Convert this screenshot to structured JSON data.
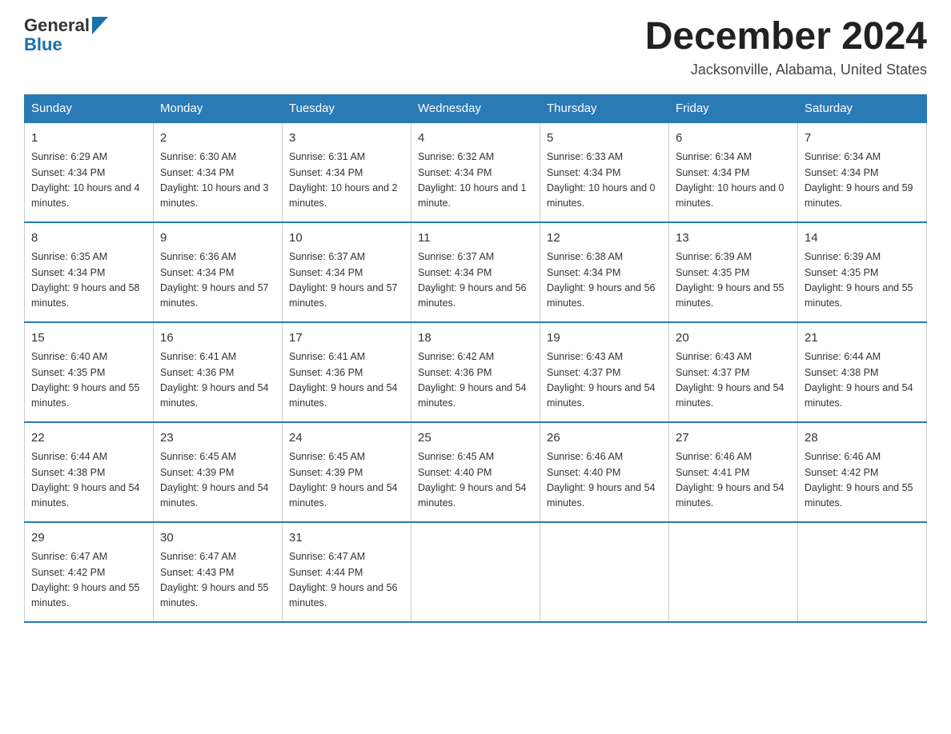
{
  "logo": {
    "general": "General",
    "blue": "Blue"
  },
  "header": {
    "title": "December 2024",
    "subtitle": "Jacksonville, Alabama, United States"
  },
  "days": [
    "Sunday",
    "Monday",
    "Tuesday",
    "Wednesday",
    "Thursday",
    "Friday",
    "Saturday"
  ],
  "weeks": [
    [
      {
        "date": "1",
        "sunrise": "6:29 AM",
        "sunset": "4:34 PM",
        "daylight": "10 hours and 4 minutes."
      },
      {
        "date": "2",
        "sunrise": "6:30 AM",
        "sunset": "4:34 PM",
        "daylight": "10 hours and 3 minutes."
      },
      {
        "date": "3",
        "sunrise": "6:31 AM",
        "sunset": "4:34 PM",
        "daylight": "10 hours and 2 minutes."
      },
      {
        "date": "4",
        "sunrise": "6:32 AM",
        "sunset": "4:34 PM",
        "daylight": "10 hours and 1 minute."
      },
      {
        "date": "5",
        "sunrise": "6:33 AM",
        "sunset": "4:34 PM",
        "daylight": "10 hours and 0 minutes."
      },
      {
        "date": "6",
        "sunrise": "6:34 AM",
        "sunset": "4:34 PM",
        "daylight": "10 hours and 0 minutes."
      },
      {
        "date": "7",
        "sunrise": "6:34 AM",
        "sunset": "4:34 PM",
        "daylight": "9 hours and 59 minutes."
      }
    ],
    [
      {
        "date": "8",
        "sunrise": "6:35 AM",
        "sunset": "4:34 PM",
        "daylight": "9 hours and 58 minutes."
      },
      {
        "date": "9",
        "sunrise": "6:36 AM",
        "sunset": "4:34 PM",
        "daylight": "9 hours and 57 minutes."
      },
      {
        "date": "10",
        "sunrise": "6:37 AM",
        "sunset": "4:34 PM",
        "daylight": "9 hours and 57 minutes."
      },
      {
        "date": "11",
        "sunrise": "6:37 AM",
        "sunset": "4:34 PM",
        "daylight": "9 hours and 56 minutes."
      },
      {
        "date": "12",
        "sunrise": "6:38 AM",
        "sunset": "4:34 PM",
        "daylight": "9 hours and 56 minutes."
      },
      {
        "date": "13",
        "sunrise": "6:39 AM",
        "sunset": "4:35 PM",
        "daylight": "9 hours and 55 minutes."
      },
      {
        "date": "14",
        "sunrise": "6:39 AM",
        "sunset": "4:35 PM",
        "daylight": "9 hours and 55 minutes."
      }
    ],
    [
      {
        "date": "15",
        "sunrise": "6:40 AM",
        "sunset": "4:35 PM",
        "daylight": "9 hours and 55 minutes."
      },
      {
        "date": "16",
        "sunrise": "6:41 AM",
        "sunset": "4:36 PM",
        "daylight": "9 hours and 54 minutes."
      },
      {
        "date": "17",
        "sunrise": "6:41 AM",
        "sunset": "4:36 PM",
        "daylight": "9 hours and 54 minutes."
      },
      {
        "date": "18",
        "sunrise": "6:42 AM",
        "sunset": "4:36 PM",
        "daylight": "9 hours and 54 minutes."
      },
      {
        "date": "19",
        "sunrise": "6:43 AM",
        "sunset": "4:37 PM",
        "daylight": "9 hours and 54 minutes."
      },
      {
        "date": "20",
        "sunrise": "6:43 AM",
        "sunset": "4:37 PM",
        "daylight": "9 hours and 54 minutes."
      },
      {
        "date": "21",
        "sunrise": "6:44 AM",
        "sunset": "4:38 PM",
        "daylight": "9 hours and 54 minutes."
      }
    ],
    [
      {
        "date": "22",
        "sunrise": "6:44 AM",
        "sunset": "4:38 PM",
        "daylight": "9 hours and 54 minutes."
      },
      {
        "date": "23",
        "sunrise": "6:45 AM",
        "sunset": "4:39 PM",
        "daylight": "9 hours and 54 minutes."
      },
      {
        "date": "24",
        "sunrise": "6:45 AM",
        "sunset": "4:39 PM",
        "daylight": "9 hours and 54 minutes."
      },
      {
        "date": "25",
        "sunrise": "6:45 AM",
        "sunset": "4:40 PM",
        "daylight": "9 hours and 54 minutes."
      },
      {
        "date": "26",
        "sunrise": "6:46 AM",
        "sunset": "4:40 PM",
        "daylight": "9 hours and 54 minutes."
      },
      {
        "date": "27",
        "sunrise": "6:46 AM",
        "sunset": "4:41 PM",
        "daylight": "9 hours and 54 minutes."
      },
      {
        "date": "28",
        "sunrise": "6:46 AM",
        "sunset": "4:42 PM",
        "daylight": "9 hours and 55 minutes."
      }
    ],
    [
      {
        "date": "29",
        "sunrise": "6:47 AM",
        "sunset": "4:42 PM",
        "daylight": "9 hours and 55 minutes."
      },
      {
        "date": "30",
        "sunrise": "6:47 AM",
        "sunset": "4:43 PM",
        "daylight": "9 hours and 55 minutes."
      },
      {
        "date": "31",
        "sunrise": "6:47 AM",
        "sunset": "4:44 PM",
        "daylight": "9 hours and 56 minutes."
      },
      null,
      null,
      null,
      null
    ]
  ]
}
